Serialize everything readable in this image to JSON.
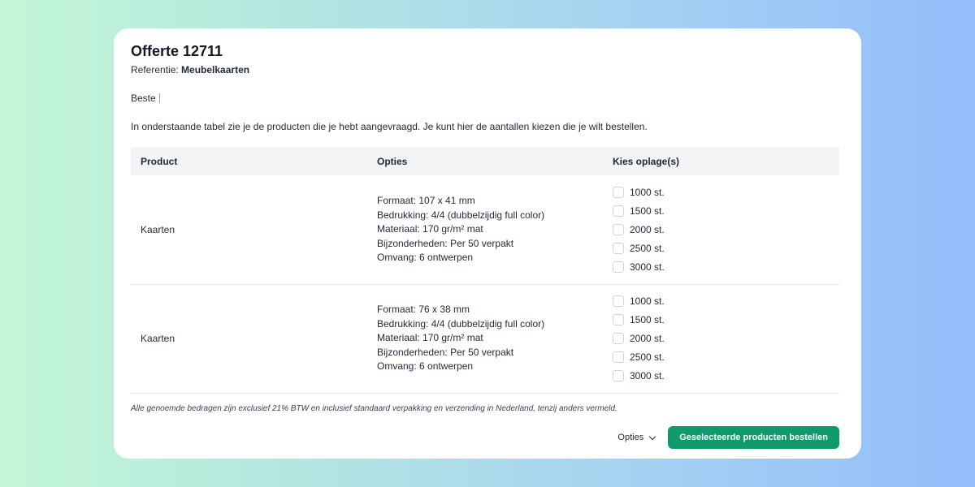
{
  "quote": {
    "title": "Offerte 12711",
    "reference_label": "Referentie: ",
    "reference_value": "Meubelkaarten",
    "greeting": "Beste",
    "intro": "In onderstaande tabel zie je de producten die je hebt aangevraagd. Je kunt hier de aantallen kiezen die je wilt bestellen."
  },
  "table": {
    "headers": [
      "Product",
      "Opties",
      "Kies oplage(s)"
    ],
    "rows": [
      {
        "product": "Kaarten",
        "options": [
          "Formaat: 107 x 41 mm",
          "Bedrukking: 4/4 (dubbelzijdig full color)",
          "Materiaal: 170 gr/m² mat",
          "Bijzonderheden: Per 50 verpakt",
          "Omvang: 6 ontwerpen"
        ],
        "quantities": [
          "1000 st.",
          "1500 st.",
          "2000 st.",
          "2500 st.",
          "3000 st."
        ]
      },
      {
        "product": "Kaarten",
        "options": [
          "Formaat: 76 x 38 mm",
          "Bedrukking: 4/4 (dubbelzijdig full color)",
          "Materiaal: 170 gr/m² mat",
          "Bijzonderheden: Per 50 verpakt",
          "Omvang: 6 ontwerpen"
        ],
        "quantities": [
          "1000 st.",
          "1500 st.",
          "2000 st.",
          "2500 st.",
          "3000 st."
        ]
      }
    ]
  },
  "disclaimer": "Alle genoemde bedragen zijn exclusief 21% BTW en inclusief standaard verpakking en verzending in Nederland, tenzij anders vermeld.",
  "footer": {
    "options_label": "Opties",
    "order_label": "Geselecteerde producten bestellen"
  },
  "colors": {
    "accent": "#10996b",
    "header_bg": "#f3f4f6"
  }
}
